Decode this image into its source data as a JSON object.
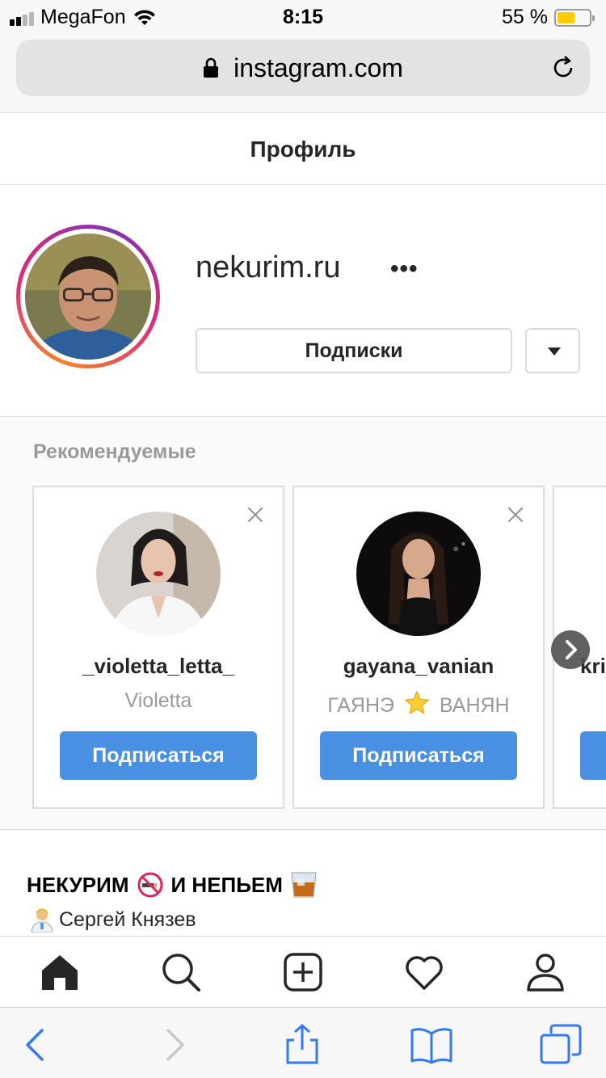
{
  "status_bar": {
    "carrier": "MegaFon",
    "time": "8:15",
    "battery_percent": "55 %",
    "battery_level": 0.55,
    "icons": [
      "signal-icon",
      "wifi-icon",
      "battery-icon"
    ]
  },
  "browser": {
    "url": "instagram.com",
    "icons": [
      "lock-icon",
      "reload-icon"
    ]
  },
  "header": {
    "title": "Профиль"
  },
  "profile": {
    "username": "nekurim.ru",
    "more_label": "•••",
    "following_label": "Подписки"
  },
  "suggestions": {
    "title": "Рекомендуемые",
    "cards": [
      {
        "username": "_violetta_letta_",
        "full_name": "Violetta",
        "follow_label": "Подписаться"
      },
      {
        "username": "gayana_vanian",
        "full_name_start": "ГАЯНЭ",
        "full_name_emoji": "star",
        "full_name_end": "ВАНЯН",
        "follow_label": "Подписаться"
      },
      {
        "username": "kri",
        "follow_label": ""
      }
    ]
  },
  "bio": {
    "title_part1": "НЕКУРИМ",
    "title_part2": "И НЕПЬЕМ",
    "name": "Сергей Князев"
  },
  "colors": {
    "accent_blue": "#4a90e2",
    "safari_blue": "#3478f6",
    "border": "#dbdbdb",
    "muted_text": "#999999"
  }
}
